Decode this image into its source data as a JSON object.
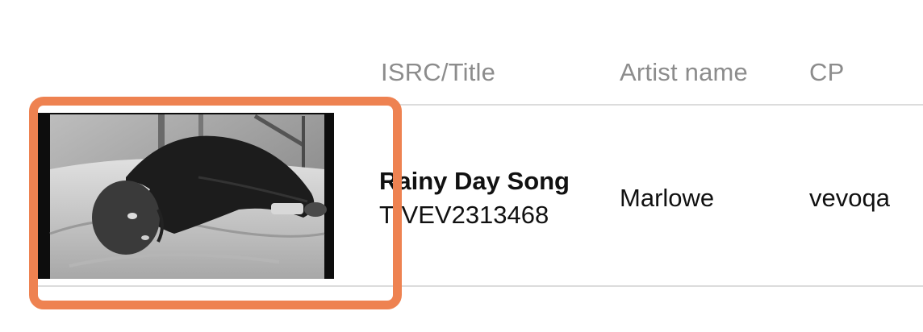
{
  "table": {
    "columns": {
      "isrc_title": "ISRC/Title",
      "artist_name": "Artist name",
      "cp": "CP"
    },
    "rows": [
      {
        "title": "Rainy Day Song",
        "isrc": "TIVEV2313468",
        "artist": "Marlowe",
        "cp": "vevoqa",
        "thumbnail": "black-and-white photo of a man in a suit lying on a bed"
      }
    ]
  },
  "colors": {
    "highlight": "#ee8251",
    "header_text": "#8c8c8c",
    "body_text": "#111111",
    "divider": "#dcdcdc"
  }
}
